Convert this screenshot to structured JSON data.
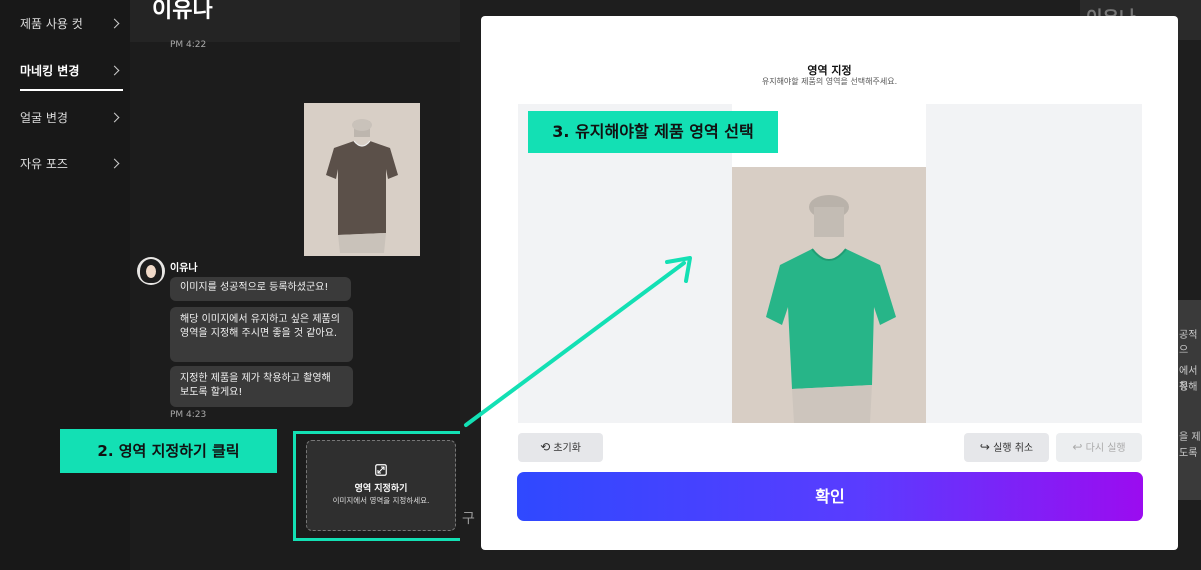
{
  "sidebar": {
    "items": [
      {
        "label": "제품 사용 컷"
      },
      {
        "label": "마네킹 변경"
      },
      {
        "label": "얼굴 변경"
      },
      {
        "label": "자유 포즈"
      }
    ]
  },
  "chat": {
    "title": "이유나",
    "time_top": "PM 4:22",
    "sender": "이유나",
    "messages": [
      "이미지를 성공적으로 등록하셨군요!",
      "해당 이미지에서 유지하고 싶은 제품의 영역을 지정해 주시면 좋을 것 같아요.",
      "지정한 제품을 제가 착용하고 촬영해 보도록 할게요!"
    ],
    "time_bottom": "PM 4:23",
    "area_card": {
      "title": "영역 지정하기",
      "subtitle": "이미지에서 영역을 지정하세요."
    }
  },
  "annotations": {
    "step2": "2. 영역 지정하기 클릭",
    "step3": "3. 유지해야할 제품 영역 선택",
    "accent_color": "#13e0b4"
  },
  "background": {
    "top_text": "이유나",
    "side_fragments": [
      "공적으",
      "에서 유",
      "정해",
      "을 제",
      "도록"
    ],
    "bottom_fragment": "구"
  },
  "modal": {
    "title": "영역 지정",
    "subtitle": "유지해야할 제품의 영역을 선택해주세요.",
    "reset_label": "초기화",
    "undo_label": "실행 취소",
    "redo_label": "다시 실행",
    "confirm_label": "확인",
    "confirm_gradient": [
      "#2f49ff",
      "#9b0cf0"
    ]
  }
}
